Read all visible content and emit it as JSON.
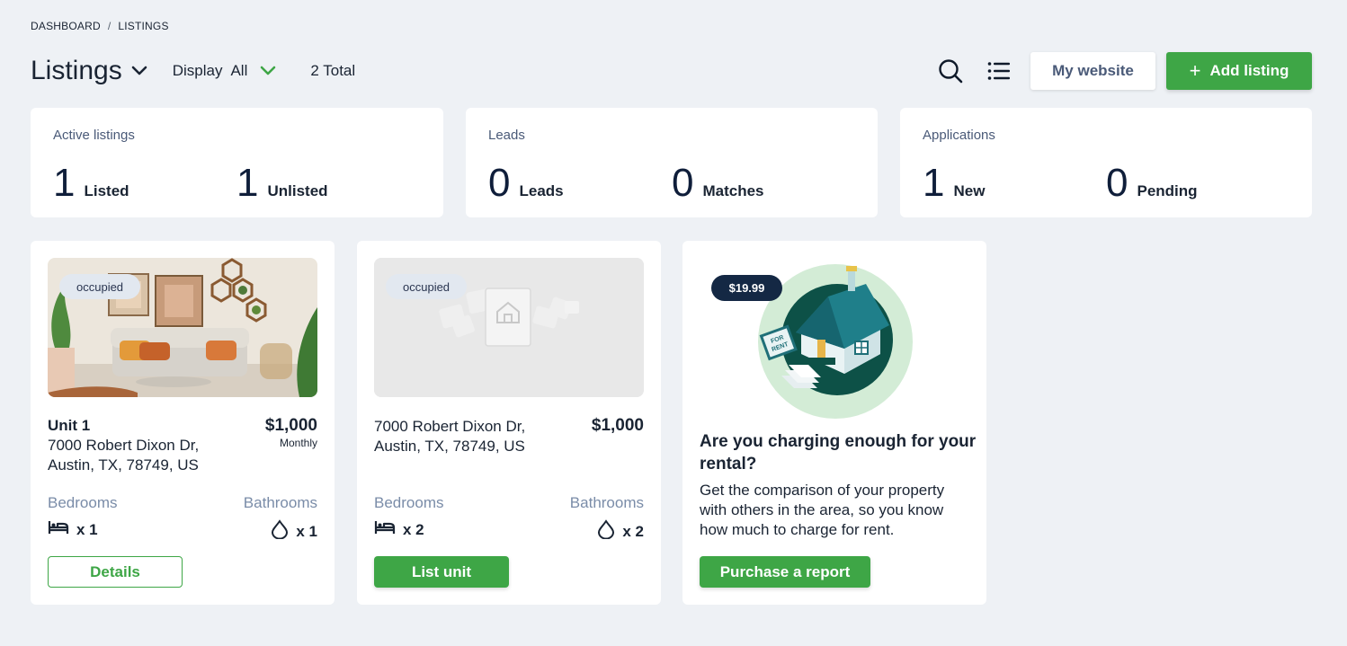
{
  "breadcrumb": {
    "items": [
      "DASHBOARD",
      "LISTINGS"
    ],
    "separator": "/"
  },
  "header": {
    "title": "Listings",
    "display_label": "Display",
    "display_value": "All",
    "total": "2 Total",
    "my_website": "My website",
    "add_listing": "Add listing",
    "add_icon": "plus-icon"
  },
  "stats": {
    "active": {
      "title": "Active listings",
      "a_num": "1",
      "a_label": "Listed",
      "b_num": "1",
      "b_label": "Unlisted"
    },
    "leads": {
      "title": "Leads",
      "a_num": "0",
      "a_label": "Leads",
      "b_num": "0",
      "b_label": "Matches"
    },
    "applications": {
      "title": "Applications",
      "a_num": "1",
      "a_label": "New",
      "b_num": "0",
      "b_label": "Pending"
    }
  },
  "listings": [
    {
      "status": "occupied",
      "name": "Unit 1",
      "address_line1": "7000 Robert Dixon Dr,",
      "address_line2": "Austin, TX, 78749, US",
      "price": "$1,000",
      "period": "Monthly",
      "bedrooms_label": "Bedrooms",
      "bathrooms_label": "Bathrooms",
      "bedrooms": "x 1",
      "bathrooms": "x 1",
      "action": "Details"
    },
    {
      "status": "occupied",
      "address_line1": "7000 Robert Dixon Dr,",
      "address_line2": "Austin, TX, 78749, US",
      "price": "$1,000",
      "bedrooms_label": "Bedrooms",
      "bathrooms_label": "Bathrooms",
      "bedrooms": "x 2",
      "bathrooms": "x 2",
      "action": "List unit"
    }
  ],
  "promo": {
    "price": "$19.99",
    "title": "Are you charging enough for your rental?",
    "text": "Get the comparison of your property with others in the area, so you know how much to charge for rent.",
    "button": "Purchase a report",
    "sign_text": "FOR RENT"
  },
  "colors": {
    "accent_green": "#3ea646",
    "navy": "#142844",
    "background": "#eef1f5",
    "muted_label": "#7a8ca8"
  }
}
